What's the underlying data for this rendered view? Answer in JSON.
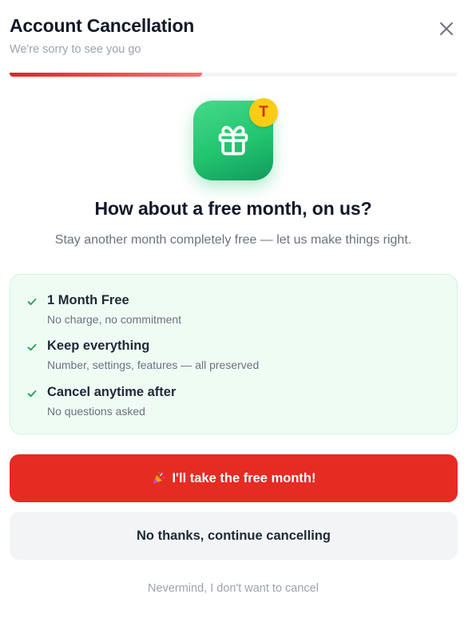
{
  "header": {
    "title": "Account Cancellation",
    "subtitle": "We're sorry to see you go",
    "close_icon": "close-icon"
  },
  "progress": {
    "fraction": 0.43,
    "color": "#dc2626"
  },
  "offer": {
    "icon": "gift-icon",
    "badge_letter": "T",
    "headline": "How about a free month, on us?",
    "description": "Stay another month completely free — let us make things right."
  },
  "benefits": [
    {
      "title": "1 Month Free",
      "subtitle": "No charge, no commitment"
    },
    {
      "title": "Keep everything",
      "subtitle": "Number, settings, features — all preserved"
    },
    {
      "title": "Cancel anytime after",
      "subtitle": "No questions asked"
    }
  ],
  "actions": {
    "accept_icon": "party-popper-icon",
    "accept_label": "I'll take the free month!",
    "decline_label": "No thanks, continue cancelling",
    "nevermind_label": "Nevermind, I don't want to cancel"
  },
  "colors": {
    "accent_red": "#e62b23",
    "success_green": "#22c56f",
    "badge_yellow": "#facc15"
  }
}
